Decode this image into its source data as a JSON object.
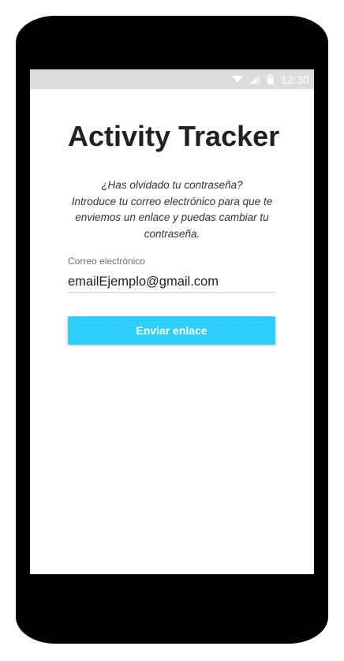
{
  "status_bar": {
    "time": "12:30",
    "icons": [
      "wifi-icon",
      "signal-icon",
      "battery-icon"
    ]
  },
  "app": {
    "title": "Activity Tracker"
  },
  "forgot_password": {
    "heading_line": "¿Has olvidado tu contraseña?",
    "body_lines": [
      "Introduce tu correo electrónico para que te",
      "enviemos un enlace y puedas cambiar tu",
      "contraseña."
    ]
  },
  "email": {
    "label": "Correo electrónico",
    "value": "emailEjemplo@gmail.com"
  },
  "actions": {
    "send_label": "Enviar enlace"
  },
  "colors": {
    "accent": "#2ecffb",
    "status_bar": "#dcdcdc",
    "device_frame": "#000000",
    "title_text": "#212121"
  }
}
